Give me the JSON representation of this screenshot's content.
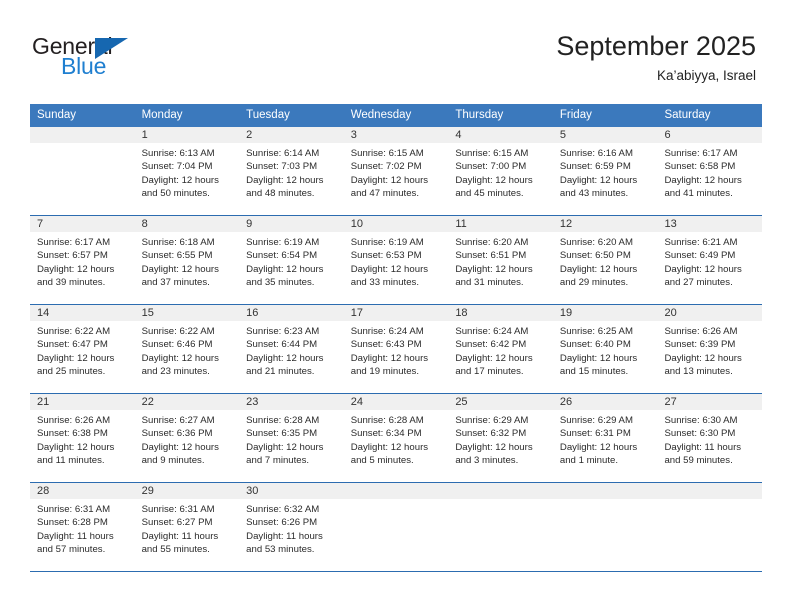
{
  "brand": {
    "name_part1": "General",
    "name_part2": "Blue",
    "triangle_color": "#1667b0",
    "blue_color": "#1f7fd0"
  },
  "header": {
    "title": "September 2025",
    "subtitle": "Ka’abiyya, Israel"
  },
  "theme": {
    "header_row_bg": "#3b79bd",
    "header_row_text": "#ffffff",
    "week_divider": "#2c6cb0",
    "day_number_bg": "#f0f0f0",
    "cell_bg": "#ffffff",
    "text": "#2b2b2b"
  },
  "weekdays": [
    "Sunday",
    "Monday",
    "Tuesday",
    "Wednesday",
    "Thursday",
    "Friday",
    "Saturday"
  ],
  "labels": {
    "sunrise_prefix": "Sunrise:",
    "sunset_prefix": "Sunset:",
    "daylight_prefix": "Daylight:"
  },
  "weeks": [
    [
      {
        "day": "",
        "sunrise": "",
        "sunset": "",
        "daylight_line1": "",
        "daylight_line2": "",
        "empty": true
      },
      {
        "day": "1",
        "sunrise": "Sunrise: 6:13 AM",
        "sunset": "Sunset: 7:04 PM",
        "daylight_line1": "Daylight: 12 hours",
        "daylight_line2": "and 50 minutes."
      },
      {
        "day": "2",
        "sunrise": "Sunrise: 6:14 AM",
        "sunset": "Sunset: 7:03 PM",
        "daylight_line1": "Daylight: 12 hours",
        "daylight_line2": "and 48 minutes."
      },
      {
        "day": "3",
        "sunrise": "Sunrise: 6:15 AM",
        "sunset": "Sunset: 7:02 PM",
        "daylight_line1": "Daylight: 12 hours",
        "daylight_line2": "and 47 minutes."
      },
      {
        "day": "4",
        "sunrise": "Sunrise: 6:15 AM",
        "sunset": "Sunset: 7:00 PM",
        "daylight_line1": "Daylight: 12 hours",
        "daylight_line2": "and 45 minutes."
      },
      {
        "day": "5",
        "sunrise": "Sunrise: 6:16 AM",
        "sunset": "Sunset: 6:59 PM",
        "daylight_line1": "Daylight: 12 hours",
        "daylight_line2": "and 43 minutes."
      },
      {
        "day": "6",
        "sunrise": "Sunrise: 6:17 AM",
        "sunset": "Sunset: 6:58 PM",
        "daylight_line1": "Daylight: 12 hours",
        "daylight_line2": "and 41 minutes."
      }
    ],
    [
      {
        "day": "7",
        "sunrise": "Sunrise: 6:17 AM",
        "sunset": "Sunset: 6:57 PM",
        "daylight_line1": "Daylight: 12 hours",
        "daylight_line2": "and 39 minutes."
      },
      {
        "day": "8",
        "sunrise": "Sunrise: 6:18 AM",
        "sunset": "Sunset: 6:55 PM",
        "daylight_line1": "Daylight: 12 hours",
        "daylight_line2": "and 37 minutes."
      },
      {
        "day": "9",
        "sunrise": "Sunrise: 6:19 AM",
        "sunset": "Sunset: 6:54 PM",
        "daylight_line1": "Daylight: 12 hours",
        "daylight_line2": "and 35 minutes."
      },
      {
        "day": "10",
        "sunrise": "Sunrise: 6:19 AM",
        "sunset": "Sunset: 6:53 PM",
        "daylight_line1": "Daylight: 12 hours",
        "daylight_line2": "and 33 minutes."
      },
      {
        "day": "11",
        "sunrise": "Sunrise: 6:20 AM",
        "sunset": "Sunset: 6:51 PM",
        "daylight_line1": "Daylight: 12 hours",
        "daylight_line2": "and 31 minutes."
      },
      {
        "day": "12",
        "sunrise": "Sunrise: 6:20 AM",
        "sunset": "Sunset: 6:50 PM",
        "daylight_line1": "Daylight: 12 hours",
        "daylight_line2": "and 29 minutes."
      },
      {
        "day": "13",
        "sunrise": "Sunrise: 6:21 AM",
        "sunset": "Sunset: 6:49 PM",
        "daylight_line1": "Daylight: 12 hours",
        "daylight_line2": "and 27 minutes."
      }
    ],
    [
      {
        "day": "14",
        "sunrise": "Sunrise: 6:22 AM",
        "sunset": "Sunset: 6:47 PM",
        "daylight_line1": "Daylight: 12 hours",
        "daylight_line2": "and 25 minutes."
      },
      {
        "day": "15",
        "sunrise": "Sunrise: 6:22 AM",
        "sunset": "Sunset: 6:46 PM",
        "daylight_line1": "Daylight: 12 hours",
        "daylight_line2": "and 23 minutes."
      },
      {
        "day": "16",
        "sunrise": "Sunrise: 6:23 AM",
        "sunset": "Sunset: 6:44 PM",
        "daylight_line1": "Daylight: 12 hours",
        "daylight_line2": "and 21 minutes."
      },
      {
        "day": "17",
        "sunrise": "Sunrise: 6:24 AM",
        "sunset": "Sunset: 6:43 PM",
        "daylight_line1": "Daylight: 12 hours",
        "daylight_line2": "and 19 minutes."
      },
      {
        "day": "18",
        "sunrise": "Sunrise: 6:24 AM",
        "sunset": "Sunset: 6:42 PM",
        "daylight_line1": "Daylight: 12 hours",
        "daylight_line2": "and 17 minutes."
      },
      {
        "day": "19",
        "sunrise": "Sunrise: 6:25 AM",
        "sunset": "Sunset: 6:40 PM",
        "daylight_line1": "Daylight: 12 hours",
        "daylight_line2": "and 15 minutes."
      },
      {
        "day": "20",
        "sunrise": "Sunrise: 6:26 AM",
        "sunset": "Sunset: 6:39 PM",
        "daylight_line1": "Daylight: 12 hours",
        "daylight_line2": "and 13 minutes."
      }
    ],
    [
      {
        "day": "21",
        "sunrise": "Sunrise: 6:26 AM",
        "sunset": "Sunset: 6:38 PM",
        "daylight_line1": "Daylight: 12 hours",
        "daylight_line2": "and 11 minutes."
      },
      {
        "day": "22",
        "sunrise": "Sunrise: 6:27 AM",
        "sunset": "Sunset: 6:36 PM",
        "daylight_line1": "Daylight: 12 hours",
        "daylight_line2": "and 9 minutes."
      },
      {
        "day": "23",
        "sunrise": "Sunrise: 6:28 AM",
        "sunset": "Sunset: 6:35 PM",
        "daylight_line1": "Daylight: 12 hours",
        "daylight_line2": "and 7 minutes."
      },
      {
        "day": "24",
        "sunrise": "Sunrise: 6:28 AM",
        "sunset": "Sunset: 6:34 PM",
        "daylight_line1": "Daylight: 12 hours",
        "daylight_line2": "and 5 minutes."
      },
      {
        "day": "25",
        "sunrise": "Sunrise: 6:29 AM",
        "sunset": "Sunset: 6:32 PM",
        "daylight_line1": "Daylight: 12 hours",
        "daylight_line2": "and 3 minutes."
      },
      {
        "day": "26",
        "sunrise": "Sunrise: 6:29 AM",
        "sunset": "Sunset: 6:31 PM",
        "daylight_line1": "Daylight: 12 hours",
        "daylight_line2": "and 1 minute."
      },
      {
        "day": "27",
        "sunrise": "Sunrise: 6:30 AM",
        "sunset": "Sunset: 6:30 PM",
        "daylight_line1": "Daylight: 11 hours",
        "daylight_line2": "and 59 minutes."
      }
    ],
    [
      {
        "day": "28",
        "sunrise": "Sunrise: 6:31 AM",
        "sunset": "Sunset: 6:28 PM",
        "daylight_line1": "Daylight: 11 hours",
        "daylight_line2": "and 57 minutes."
      },
      {
        "day": "29",
        "sunrise": "Sunrise: 6:31 AM",
        "sunset": "Sunset: 6:27 PM",
        "daylight_line1": "Daylight: 11 hours",
        "daylight_line2": "and 55 minutes."
      },
      {
        "day": "30",
        "sunrise": "Sunrise: 6:32 AM",
        "sunset": "Sunset: 6:26 PM",
        "daylight_line1": "Daylight: 11 hours",
        "daylight_line2": "and 53 minutes."
      },
      {
        "day": "",
        "sunrise": "",
        "sunset": "",
        "daylight_line1": "",
        "daylight_line2": "",
        "empty": true
      },
      {
        "day": "",
        "sunrise": "",
        "sunset": "",
        "daylight_line1": "",
        "daylight_line2": "",
        "empty": true
      },
      {
        "day": "",
        "sunrise": "",
        "sunset": "",
        "daylight_line1": "",
        "daylight_line2": "",
        "empty": true
      },
      {
        "day": "",
        "sunrise": "",
        "sunset": "",
        "daylight_line1": "",
        "daylight_line2": "",
        "empty": true
      }
    ]
  ]
}
